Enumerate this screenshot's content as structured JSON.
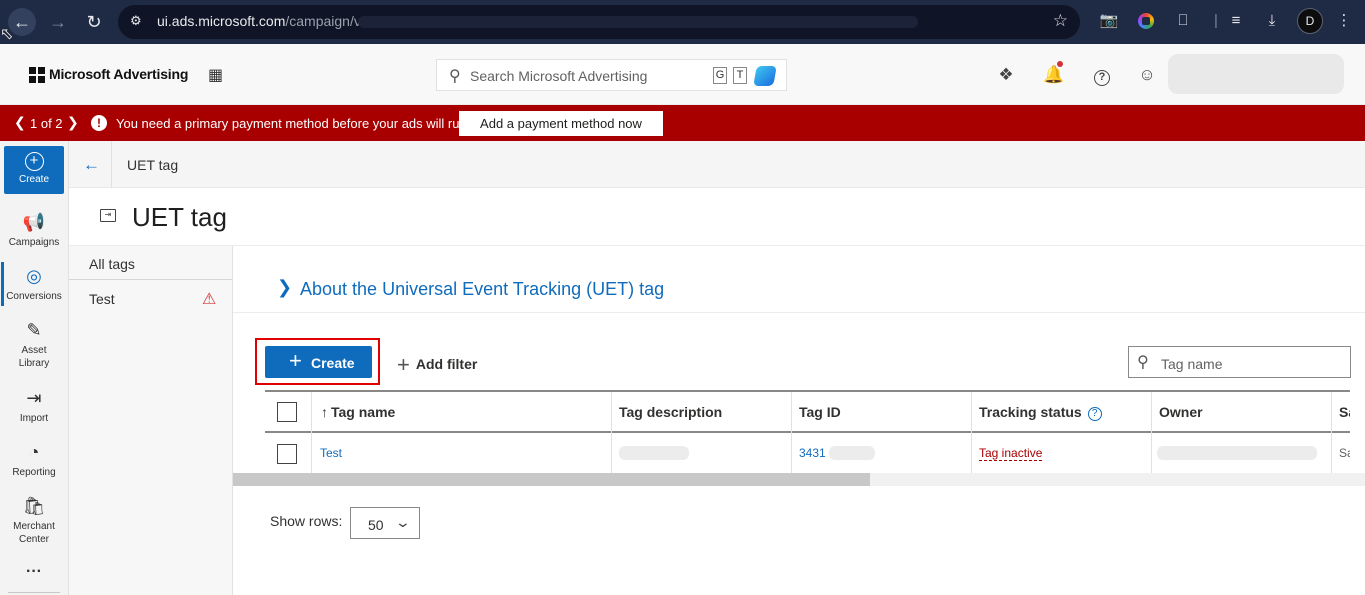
{
  "browser": {
    "url_domain": "ui.ads.microsoft.com",
    "url_path": "/campaign/v",
    "profile_initial": "D"
  },
  "header": {
    "brand": "Microsoft Advertising",
    "search_placeholder": "Search Microsoft Advertising",
    "shortcut_g": "G",
    "shortcut_t": "T"
  },
  "banner": {
    "pager": "1 of 2",
    "message": "You need a primary payment method before your ads will run.",
    "action": "Add a payment method now"
  },
  "rail": {
    "create": "Create",
    "items": [
      "Campaigns",
      "Conversions",
      "Asset Library",
      "Import",
      "Reporting",
      "Merchant Center"
    ],
    "more": "···"
  },
  "breadcrumb": "UET tag",
  "page_title": "UET tag",
  "tags_pane": {
    "all_tags": "All tags",
    "tags": [
      "Test"
    ]
  },
  "about_link": "About the Universal Event Tracking (UET) tag",
  "toolbar": {
    "create": "Create",
    "add_filter": "Add filter",
    "filter_placeholder": "Tag name"
  },
  "table": {
    "columns": [
      "Tag name",
      "Tag description",
      "Tag ID",
      "Tracking status",
      "Owner",
      "Sa"
    ],
    "rows": [
      {
        "tag_name": "Test",
        "tag_id": "3431",
        "tracking_status": "Tag inactive",
        "sa": "Sa"
      }
    ]
  },
  "footer": {
    "show_rows_label": "Show rows:",
    "rows_value": "50"
  },
  "colors": {
    "accent": "#0f6cbd",
    "banner": "#a80000",
    "highlight": "#e00000"
  }
}
